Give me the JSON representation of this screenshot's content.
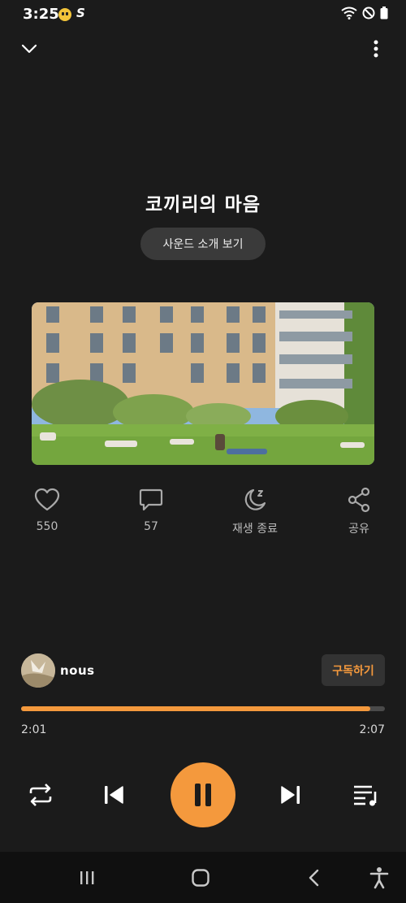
{
  "status": {
    "time": "3:25",
    "s_glyph": "S"
  },
  "track": {
    "title": "코끼리의 마음",
    "sound_intro_label": "사운드 소개 보기"
  },
  "actions": {
    "like_count": "550",
    "comment_count": "57",
    "sleep_label": "재생 종료",
    "share_label": "공유"
  },
  "artist": {
    "name": "nous",
    "subscribe_label": "구독하기"
  },
  "playback": {
    "elapsed": "2:01",
    "total": "2:07",
    "progress": 0.96
  },
  "colors": {
    "accent": "#f4993d",
    "background": "#1b1b1b"
  }
}
